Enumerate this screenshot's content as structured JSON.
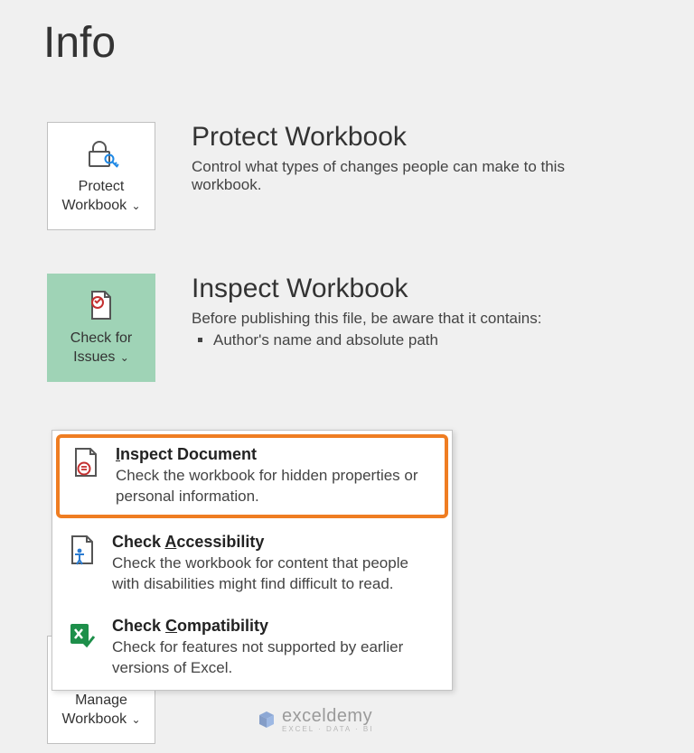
{
  "page": {
    "title": "Info"
  },
  "protect": {
    "tile_label_line1": "Protect",
    "tile_label_line2": "Workbook",
    "heading": "Protect Workbook",
    "desc": "Control what types of changes people can make to this workbook."
  },
  "inspect": {
    "tile_label_line1": "Check for",
    "tile_label_line2": "Issues",
    "heading": "Inspect Workbook",
    "desc": "Before publishing this file, be aware that it contains:",
    "bullet1": "Author's name and absolute path"
  },
  "manage": {
    "tile_label_line1": "Manage",
    "tile_label_line2": "Workbook"
  },
  "menu": {
    "inspect_doc": {
      "title_pre": "I",
      "title_post": "nspect Document",
      "desc": "Check the workbook for hidden properties or personal information."
    },
    "accessibility": {
      "title_pre": "Check ",
      "title_u": "A",
      "title_post": "ccessibility",
      "desc": "Check the workbook for content that people with disabilities might find difficult to read."
    },
    "compatibility": {
      "title_pre": "Check ",
      "title_u": "C",
      "title_post": "ompatibility",
      "desc": "Check for features not supported by earlier versions of Excel."
    }
  },
  "watermark": {
    "brand": "exceldemy",
    "tagline": "EXCEL · DATA · BI"
  }
}
